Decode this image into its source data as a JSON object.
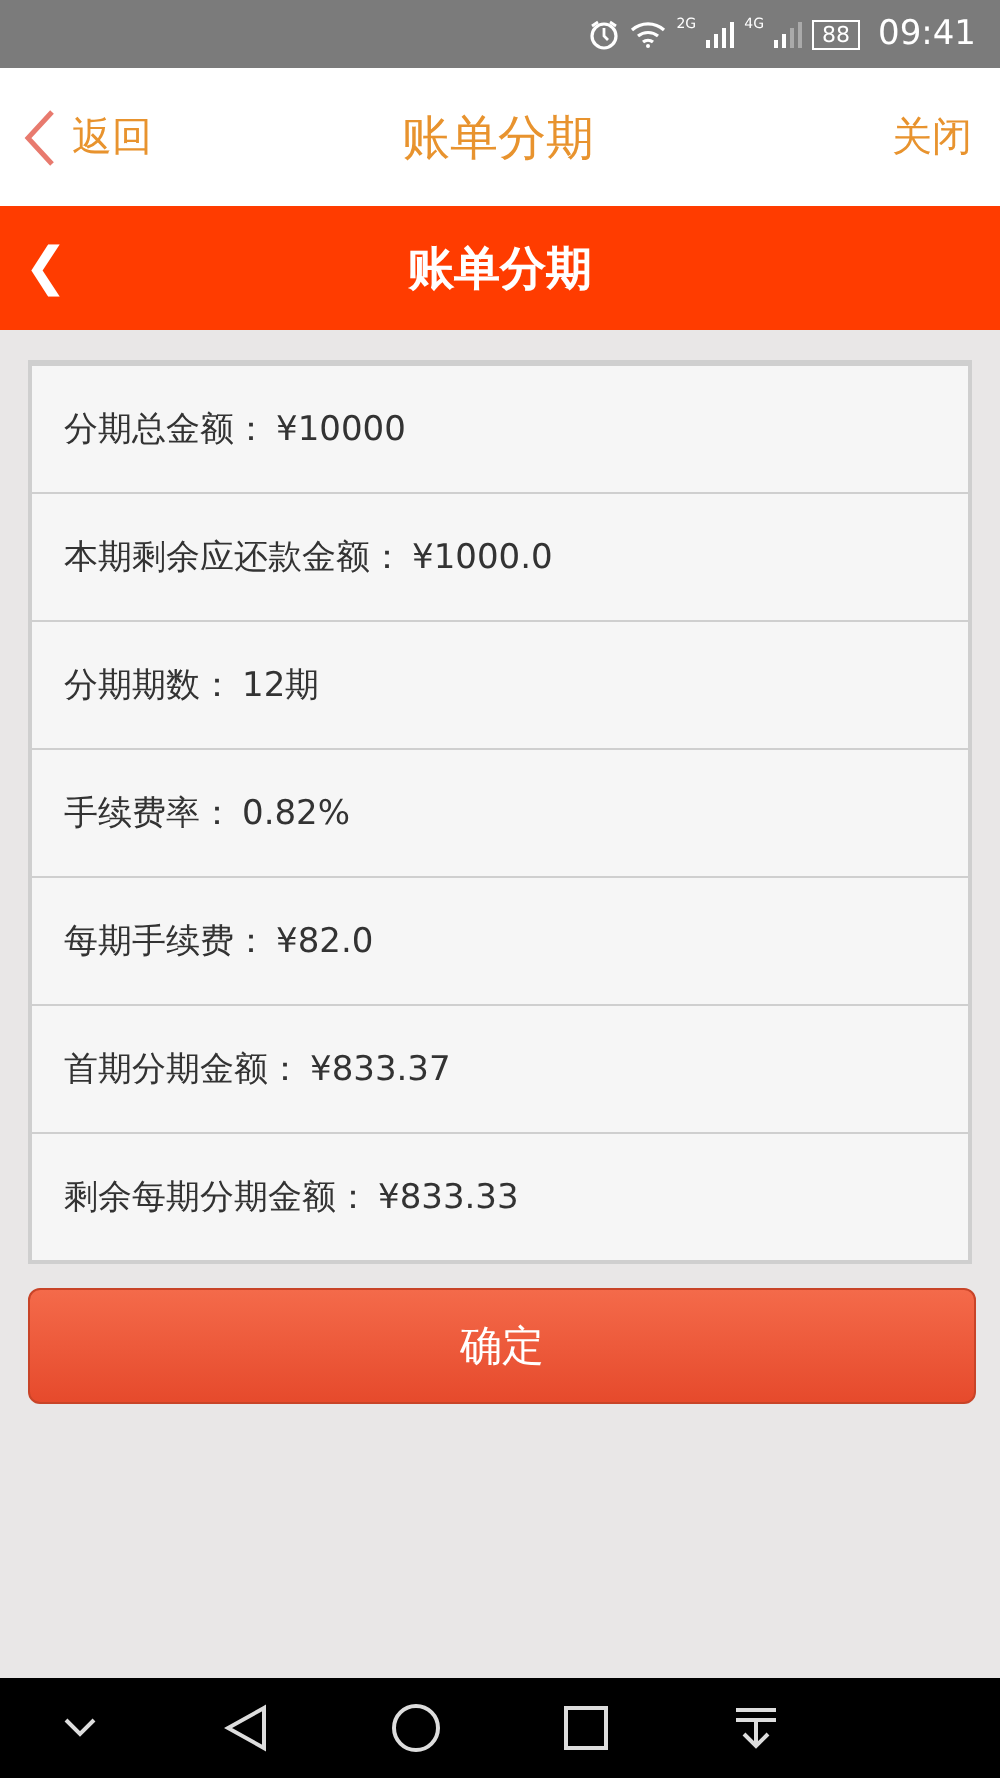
{
  "status_bar": {
    "network_2g": "2G",
    "network_4g": "4G",
    "battery": "88",
    "time": "09:41"
  },
  "header": {
    "back": "返回",
    "title": "账单分期",
    "close": "关闭"
  },
  "title_bar": {
    "back": "❮",
    "title": "账单分期"
  },
  "rows": [
    {
      "label": "分期总金额：",
      "value": "¥10000"
    },
    {
      "label": "本期剩余应还款金额：",
      "value": "¥1000.0"
    },
    {
      "label": "分期期数：",
      "value": "12期"
    },
    {
      "label": "手续费率：",
      "value": "0.82%"
    },
    {
      "label": "每期手续费：",
      "value": "¥82.0"
    },
    {
      "label": "首期分期金额：",
      "value": "¥833.37"
    },
    {
      "label": "剩余每期分期金额：",
      "value": "¥833.33"
    }
  ],
  "confirm_button": "确定"
}
